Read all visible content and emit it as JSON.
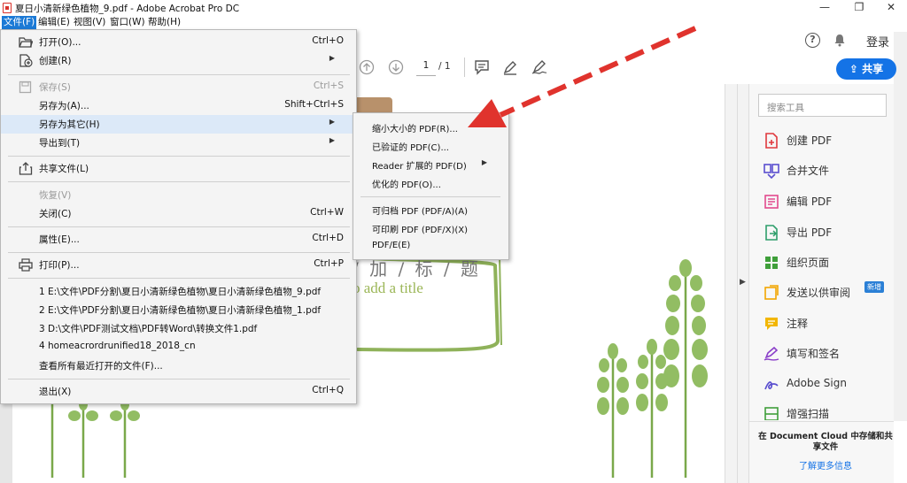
{
  "window": {
    "title": "夏日小清新绿色植物_9.pdf - Adobe Acrobat Pro DC",
    "min_symbol": "—",
    "restore_symbol": "❐",
    "close_symbol": "✕"
  },
  "menubar": {
    "items": [
      {
        "label": "文件(F)",
        "active": true
      },
      {
        "label": "编辑(E)"
      },
      {
        "label": "视图(V)"
      },
      {
        "label": "窗口(W)"
      },
      {
        "label": "帮助(H)"
      }
    ]
  },
  "header": {
    "help_symbol": "?",
    "login_label": "登录",
    "share_label": "共享",
    "page_current": "1",
    "page_total": "/ 1"
  },
  "file_menu": {
    "open": {
      "label": "打开(O)...",
      "shortcut": "Ctrl+O"
    },
    "create": {
      "label": "创建(R)"
    },
    "save": {
      "label": "保存(S)",
      "shortcut": "Ctrl+S"
    },
    "save_as": {
      "label": "另存为(A)...",
      "shortcut": "Shift+Ctrl+S"
    },
    "save_as_other": {
      "label": "另存为其它(H)"
    },
    "export_to": {
      "label": "导出到(T)"
    },
    "share_file": {
      "label": "共享文件(L)"
    },
    "revert": {
      "label": "恢复(V)"
    },
    "close": {
      "label": "关闭(C)",
      "shortcut": "Ctrl+W"
    },
    "properties": {
      "label": "属性(E)...",
      "shortcut": "Ctrl+D"
    },
    "print": {
      "label": "打印(P)...",
      "shortcut": "Ctrl+P"
    },
    "recent": [
      "1 E:\\文件\\PDF分割\\夏日小清新绿色植物\\夏日小清新绿色植物_9.pdf",
      "2 E:\\文件\\PDF分割\\夏日小清新绿色植物\\夏日小清新绿色植物_1.pdf",
      "3 D:\\文件\\PDF测试文档\\PDF转Word\\转换文件1.pdf",
      "4 homeacrordrunified18_2018_cn"
    ],
    "view_all_recent": {
      "label": "查看所有最近打开的文件(F)..."
    },
    "exit": {
      "label": "退出(X)",
      "shortcut": "Ctrl+Q"
    }
  },
  "save_as_other_menu": {
    "items": [
      "缩小大小的 PDF(R)...",
      "已验证的 PDF(C)...",
      "Reader 扩展的 PDF(D)",
      "优化的 PDF(O)...",
      "可归档 PDF (PDF/A)(A)",
      "可印刷 PDF (PDF/X)(X)",
      "PDF/E(E)"
    ]
  },
  "tools_pane": {
    "search_placeholder": "搜索工具",
    "tools": [
      {
        "label": "创建 PDF",
        "icon": "create-pdf-icon",
        "color": "#e0393e"
      },
      {
        "label": "合并文件",
        "icon": "combine-files-icon",
        "color": "#5a4fcf"
      },
      {
        "label": "编辑 PDF",
        "icon": "edit-pdf-icon",
        "color": "#e24a8d"
      },
      {
        "label": "导出 PDF",
        "icon": "export-pdf-icon",
        "color": "#2e9e6b"
      },
      {
        "label": "组织页面",
        "icon": "organize-pages-icon",
        "color": "#3f9f3a"
      },
      {
        "label": "发送以供审阅",
        "icon": "send-review-icon",
        "color": "#f2a600"
      },
      {
        "label": "注释",
        "icon": "comment-icon",
        "color": "#f2b600"
      },
      {
        "label": "填写和签名",
        "icon": "fill-sign-icon",
        "color": "#8a3fc9"
      },
      {
        "label": "Adobe Sign",
        "icon": "adobe-sign-icon",
        "color": "#5a4fcf"
      },
      {
        "label": "增强扫描",
        "icon": "enhance-scan-icon",
        "color": "#3f9f3a"
      }
    ],
    "new_badge": "新增",
    "cloud_text": "在 Document Cloud 中存储和共享文件",
    "learn_more": "了解更多信息"
  },
  "page_content": {
    "title_cn": "/ 加 / 标 / 题",
    "title_en": "o add a title"
  },
  "colors": {
    "accent": "#1473e6",
    "menu_highlight": "#dce9f8",
    "active_menu": "#1c7ad6",
    "arrow_red": "#e0332d",
    "plant_green": "#7aa84a"
  }
}
